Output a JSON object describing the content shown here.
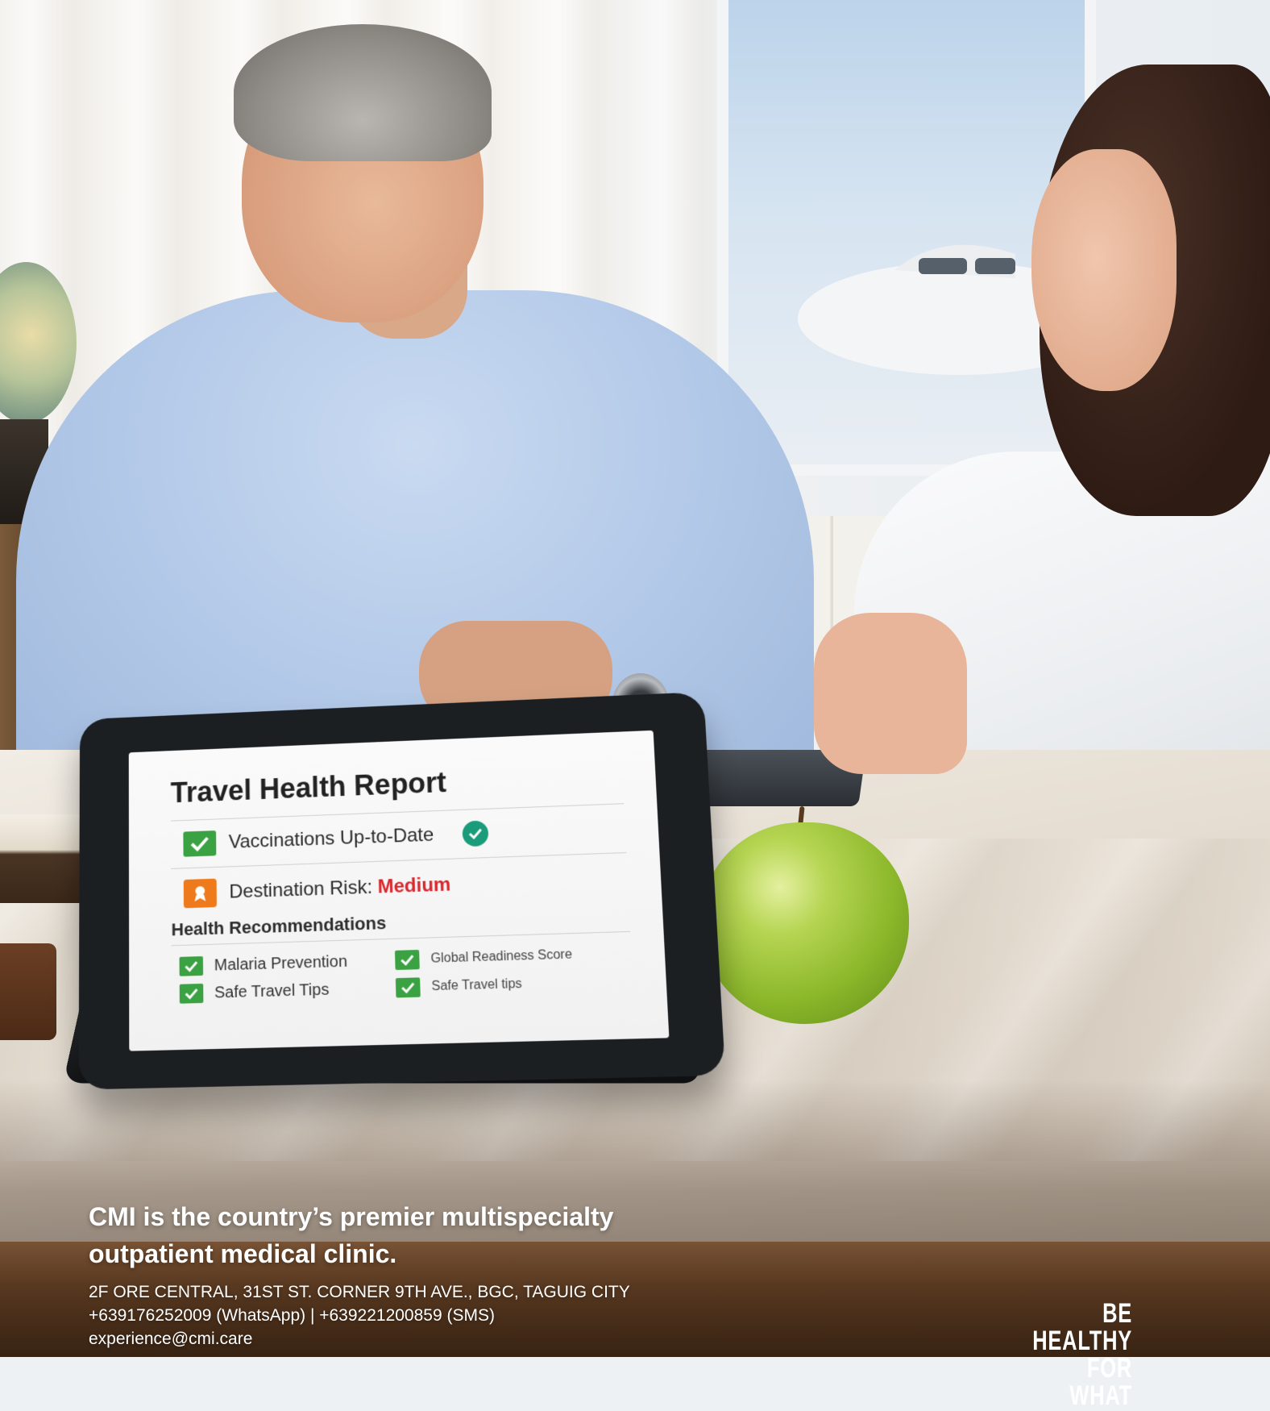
{
  "report": {
    "title": "Travel Health Report",
    "vaccinations": "Vaccinations Up-to-Date",
    "risk_label": "Destination Risk:",
    "risk_value": "Medium",
    "recommendations_title": "Health Recommendations",
    "recommendations": [
      "Malaria Prevention",
      "Global Readiness Score",
      "Safe Travel Tips",
      "Safe Travel tips"
    ]
  },
  "footer": {
    "headline_line1": "CMI is the country’s premier multispecialty",
    "headline_line2": "outpatient medical clinic.",
    "address": "2F ORE CENTRAL, 31ST ST. CORNER 9TH AVE., BGC, TAGUIG CITY",
    "phones": "+639176252009 (WhatsApp) | +639221200859 (SMS)",
    "email": "experience@cmi.care",
    "tagline_line1": "BE HEALTHY",
    "tagline_line2": "FOR WHAT"
  },
  "colors": {
    "check_green": "#3ba243",
    "risk_red": "#d9272e",
    "risk_icon_orange": "#ef7a1c",
    "badge_teal": "#1a9c7b"
  }
}
